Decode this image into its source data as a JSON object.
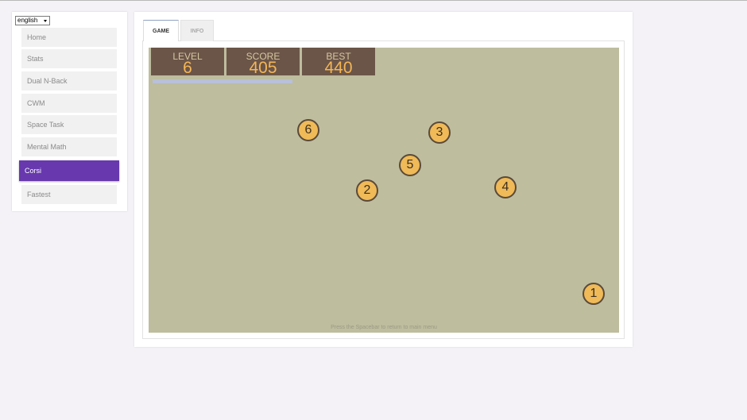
{
  "language": {
    "selected": "english"
  },
  "sidebar": {
    "items": [
      {
        "label": "Home"
      },
      {
        "label": "Stats"
      },
      {
        "label": "Dual N-Back"
      },
      {
        "label": "CWM"
      },
      {
        "label": "Space Task"
      },
      {
        "label": "Mental Math"
      },
      {
        "label": "Corsi",
        "active": true
      },
      {
        "label": "Fastest"
      }
    ]
  },
  "tabs": [
    {
      "label": "GAME",
      "active": true
    },
    {
      "label": "INFO"
    }
  ],
  "game": {
    "level_label": "LEVEL",
    "level": "6",
    "score_label": "SCORE",
    "score": "405",
    "best_label": "BEST",
    "best": "440",
    "tiles": [
      "6",
      "3",
      "5",
      "2",
      "4",
      "1"
    ],
    "hint": "Press the Spacebar to return to main menu"
  },
  "colors": {
    "accent": "#6738ae",
    "board": "#bebd9e",
    "stat_bg": "#6b5548",
    "stat_text": "#f4b657",
    "tile": "#efba57"
  }
}
